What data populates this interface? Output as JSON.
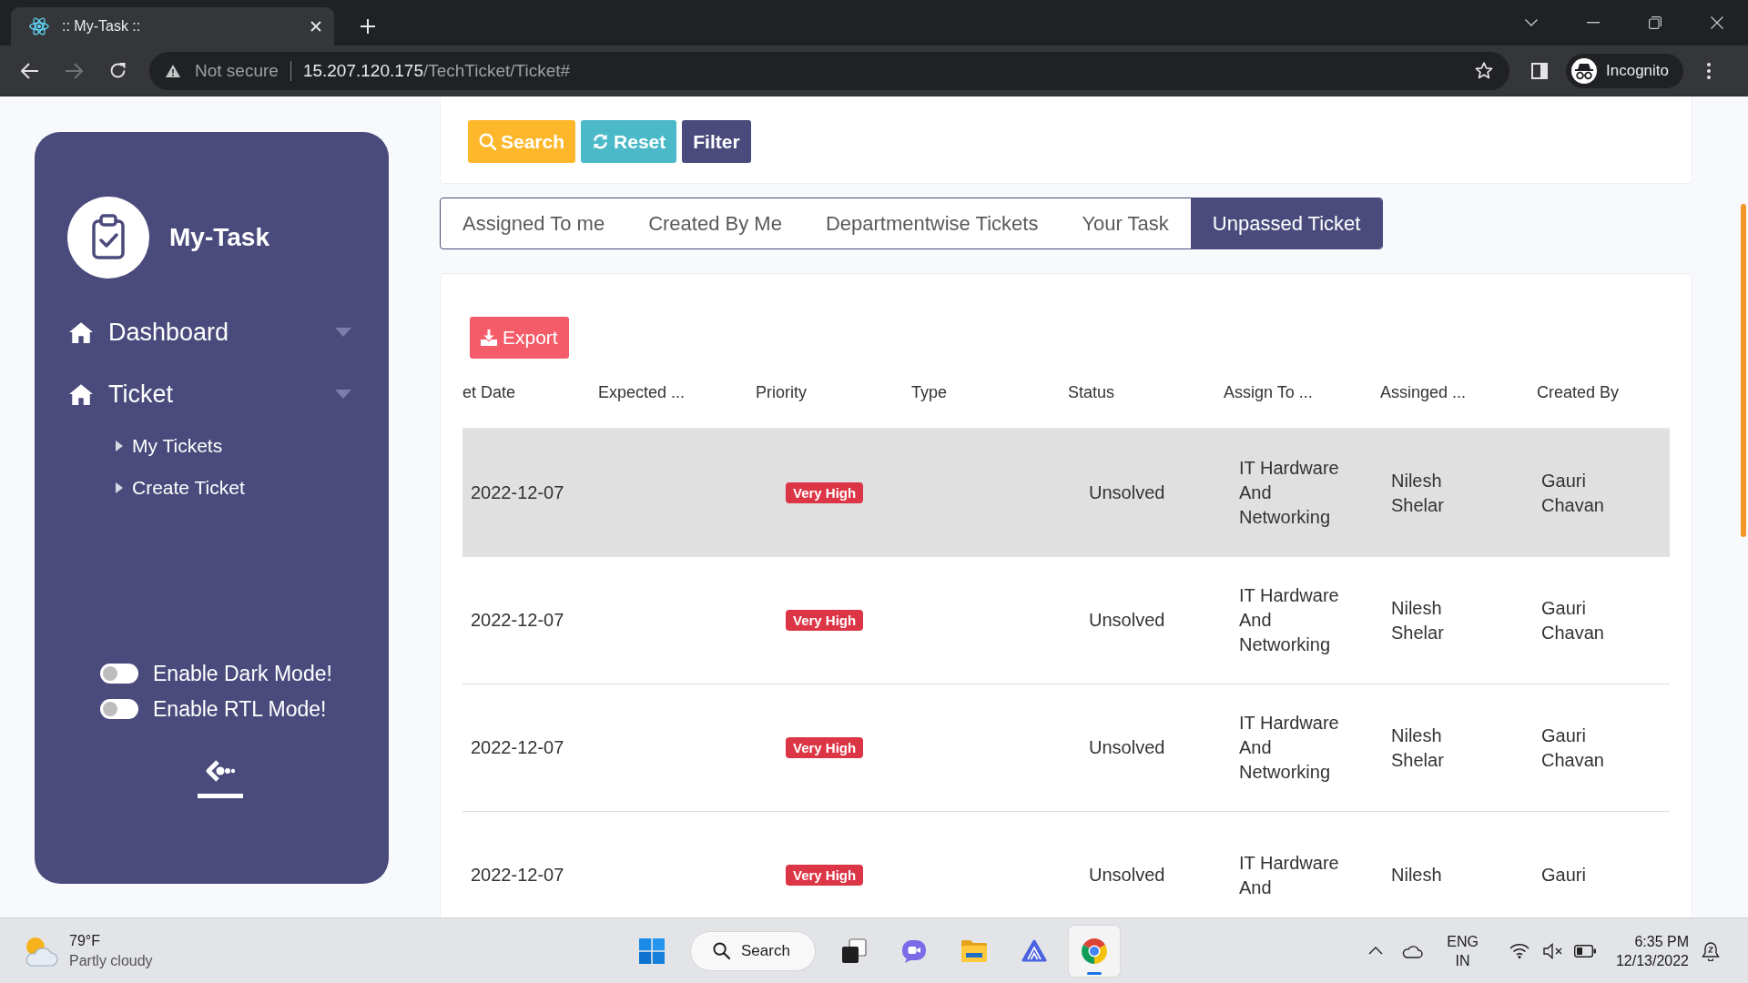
{
  "browser": {
    "tab_title": ":: My-Task ::",
    "security": "Not secure",
    "host": "15.207.120.175",
    "path": "/TechTicket/Ticket#",
    "profile": "Incognito"
  },
  "sidebar": {
    "brand": "My-Task",
    "nav": [
      {
        "label": "Dashboard"
      },
      {
        "label": "Ticket",
        "children": [
          {
            "label": "My Tickets"
          },
          {
            "label": "Create Ticket"
          }
        ]
      }
    ],
    "toggles": [
      {
        "label": "Enable Dark Mode!",
        "on": false
      },
      {
        "label": "Enable RTL Mode!",
        "on": false
      }
    ]
  },
  "filter_buttons": [
    {
      "label": "Search",
      "kind": "search"
    },
    {
      "label": "Reset",
      "kind": "reset"
    },
    {
      "label": "Filter",
      "kind": "filter"
    }
  ],
  "tabs": [
    {
      "label": "Assigned To me",
      "selected": false
    },
    {
      "label": "Created By Me",
      "selected": false
    },
    {
      "label": "Departmentwise Tickets",
      "selected": false
    },
    {
      "label": "Your Task",
      "selected": false
    },
    {
      "label": "Unpassed Ticket",
      "selected": true
    }
  ],
  "export_button": "Export",
  "table": {
    "columns": [
      "et Date",
      "Expected ...",
      "Priority",
      "Type",
      "Status",
      "Assign To ...",
      "Assinged ...",
      "Created By"
    ],
    "rows": [
      {
        "selected": true,
        "date": "2022-12-07",
        "priority": "Very High",
        "status": "Unsolved",
        "assign_to": "IT Hardware And Networking",
        "assigned": "Nilesh Shelar",
        "created_by": "Gauri Chavan"
      },
      {
        "selected": false,
        "date": "2022-12-07",
        "priority": "Very High",
        "status": "Unsolved",
        "assign_to": "IT Hardware And Networking",
        "assigned": "Nilesh Shelar",
        "created_by": "Gauri Chavan"
      },
      {
        "selected": false,
        "date": "2022-12-07",
        "priority": "Very High",
        "status": "Unsolved",
        "assign_to": "IT Hardware And Networking",
        "assigned": "Nilesh Shelar",
        "created_by": "Gauri Chavan"
      },
      {
        "selected": false,
        "date": "2022-12-07",
        "priority": "Very High",
        "status": "Unsolved",
        "assign_to": "IT Hardware And",
        "assigned": "Nilesh",
        "created_by": "Gauri"
      }
    ]
  },
  "taskbar": {
    "weather": {
      "temperature": "79°F",
      "condition": "Partly cloudy"
    },
    "search_button": "Search",
    "apps": [
      {
        "kind": "task-view",
        "active": false
      },
      {
        "kind": "chat",
        "active": false
      },
      {
        "kind": "folder",
        "active": false
      },
      {
        "kind": "app",
        "active": false
      },
      {
        "kind": "browser",
        "active": true
      }
    ],
    "language": "ENG",
    "region": "IN",
    "time": "6:35 PM",
    "date": "12/13/2022"
  }
}
